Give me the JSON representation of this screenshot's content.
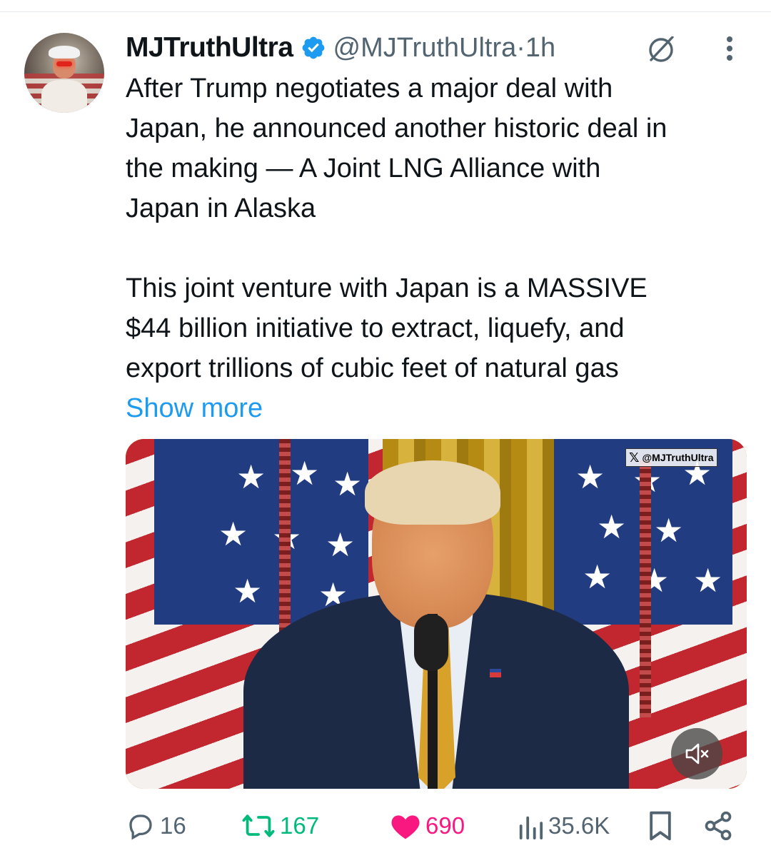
{
  "author": {
    "display_name": "MJTruthUltra",
    "handle": "@MJTruthUltra",
    "separator": " · ",
    "time": "1h",
    "verified_color": "#1d9bf0"
  },
  "tweet": {
    "paragraph_1": "After Trump negotiates a major deal with\nJapan, he announced another historic deal in\nthe making — A Joint LNG Alliance with\nJapan in Alaska",
    "paragraph_2": "This joint venture with Japan is a MASSIVE\n$44 billion initiative to extract, liquefy, and\nexport trillions of cubic feet of natural gas",
    "show_more_label": "Show more"
  },
  "media": {
    "watermark": "@MJTruthUltra",
    "mute_icon": "speaker-muted-icon"
  },
  "actions": {
    "replies": "16",
    "reposts": "167",
    "likes": "690",
    "views": "35.6K"
  },
  "icons": {
    "grok": "grok-icon",
    "more": "more-vertical-icon",
    "reply": "reply-icon",
    "repost": "repost-icon",
    "like": "heart-icon",
    "views": "views-icon",
    "bookmark": "bookmark-icon",
    "share": "share-icon"
  },
  "colors": {
    "accent": "#1d9bf0",
    "repost": "#00ba7c",
    "like": "#f91880",
    "muted": "#536471"
  }
}
